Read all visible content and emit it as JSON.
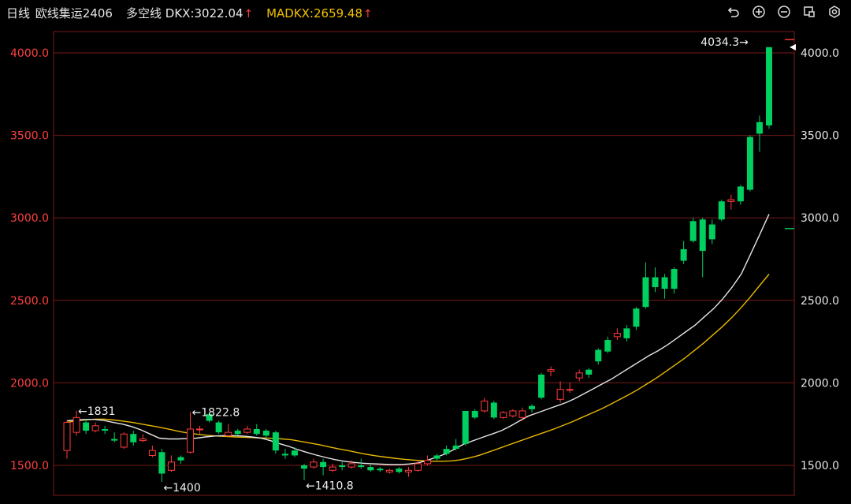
{
  "header": {
    "title_period": "日线",
    "title_symbol": "欧线集运2406",
    "ind_name": "多空线",
    "dkx_label": "DKX:",
    "dkx_value": "3022.04",
    "madkx_label": "MADKX:",
    "madkx_value": "2659.48",
    "up_arrow": "↑"
  },
  "icons": [
    "undo-icon",
    "zoom-in-icon",
    "zoom-out-icon",
    "crop-icon",
    "settings-icon"
  ],
  "colors": {
    "up": "#ff3b3b",
    "down": "#00d060",
    "grid": "#7a1a1a",
    "dkx": "#e6e6e6",
    "madkx": "#e8b800",
    "axis_text": "#ff4040",
    "right_axis_text": "#e6e6e6"
  },
  "chart_data": {
    "type": "candlestick",
    "ylim": [
      1380,
      4120
    ],
    "yticks": [
      "1500.0",
      "2000.0",
      "2500.0",
      "3000.0",
      "3500.0",
      "4000.0"
    ],
    "ytick_values": [
      1500,
      2000,
      2500,
      3000,
      3500,
      4000
    ],
    "annotations": [
      {
        "text": "←1831",
        "index": 1,
        "value": 1831,
        "side": "high"
      },
      {
        "text": "←1400",
        "index": 10,
        "value": 1400,
        "side": "low"
      },
      {
        "text": "←1822.8",
        "index": 13,
        "value": 1822.8,
        "side": "high"
      },
      {
        "text": "←1410.8",
        "index": 25,
        "value": 1410.8,
        "side": "low"
      },
      {
        "text": "4034.3→",
        "index": 72,
        "value": 4034.3,
        "side": "high-left"
      }
    ],
    "candles": [
      [
        1590,
        1760,
        1540,
        1770
      ],
      [
        1700,
        1790,
        1680,
        1831
      ],
      [
        1760,
        1710,
        1690,
        1780
      ],
      [
        1710,
        1740,
        1700,
        1760
      ],
      [
        1720,
        1710,
        1690,
        1740
      ],
      [
        1660,
        1650,
        1640,
        1700
      ],
      [
        1610,
        1690,
        1600,
        1700
      ],
      [
        1690,
        1640,
        1620,
        1710
      ],
      [
        1650,
        1660,
        1640,
        1690
      ],
      [
        1560,
        1590,
        1550,
        1620
      ],
      [
        1580,
        1450,
        1400,
        1600
      ],
      [
        1470,
        1520,
        1460,
        1560
      ],
      [
        1550,
        1530,
        1510,
        1560
      ],
      [
        1580,
        1720,
        1570,
        1822.8
      ],
      [
        1720,
        1720,
        1690,
        1740
      ],
      [
        1810,
        1770,
        1760,
        1820
      ],
      [
        1760,
        1700,
        1690,
        1770
      ],
      [
        1680,
        1700,
        1670,
        1750
      ],
      [
        1710,
        1690,
        1680,
        1720
      ],
      [
        1700,
        1720,
        1690,
        1740
      ],
      [
        1720,
        1690,
        1680,
        1750
      ],
      [
        1710,
        1680,
        1660,
        1720
      ],
      [
        1700,
        1590,
        1570,
        1710
      ],
      [
        1570,
        1560,
        1540,
        1600
      ],
      [
        1590,
        1560,
        1550,
        1610
      ],
      [
        1500,
        1480,
        1410.8,
        1510
      ],
      [
        1490,
        1520,
        1480,
        1540
      ],
      [
        1520,
        1490,
        1440,
        1540
      ],
      [
        1470,
        1490,
        1460,
        1510
      ],
      [
        1500,
        1490,
        1470,
        1520
      ],
      [
        1490,
        1510,
        1480,
        1530
      ],
      [
        1500,
        1490,
        1480,
        1540
      ],
      [
        1490,
        1470,
        1460,
        1510
      ],
      [
        1480,
        1470,
        1460,
        1490
      ],
      [
        1460,
        1470,
        1450,
        1480
      ],
      [
        1480,
        1460,
        1450,
        1490
      ],
      [
        1460,
        1470,
        1430,
        1490
      ],
      [
        1470,
        1510,
        1460,
        1530
      ],
      [
        1510,
        1530,
        1500,
        1560
      ],
      [
        1560,
        1540,
        1530,
        1570
      ],
      [
        1600,
        1570,
        1560,
        1620
      ],
      [
        1620,
        1600,
        1590,
        1660
      ],
      [
        1830,
        1630,
        1620,
        1830
      ],
      [
        1830,
        1790,
        1780,
        1840
      ],
      [
        1830,
        1890,
        1820,
        1910
      ],
      [
        1880,
        1790,
        1780,
        1890
      ],
      [
        1790,
        1820,
        1780,
        1830
      ],
      [
        1800,
        1830,
        1790,
        1840
      ],
      [
        1790,
        1830,
        1770,
        1850
      ],
      [
        1860,
        1840,
        1820,
        1870
      ],
      [
        2050,
        1910,
        1900,
        2060
      ],
      [
        2070,
        2080,
        2040,
        2100
      ],
      [
        1900,
        1960,
        1880,
        2010
      ],
      [
        1960,
        1960,
        1940,
        2000
      ],
      [
        2030,
        2060,
        2010,
        2080
      ],
      [
        2080,
        2050,
        2030,
        2090
      ],
      [
        2200,
        2130,
        2110,
        2210
      ],
      [
        2260,
        2190,
        2180,
        2280
      ],
      [
        2280,
        2300,
        2260,
        2330
      ],
      [
        2330,
        2270,
        2250,
        2350
      ],
      [
        2450,
        2340,
        2320,
        2460
      ],
      [
        2640,
        2460,
        2450,
        2730
      ],
      [
        2640,
        2580,
        2550,
        2700
      ],
      [
        2640,
        2570,
        2510,
        2660
      ],
      [
        2690,
        2570,
        2540,
        2700
      ],
      [
        2810,
        2740,
        2720,
        2860
      ],
      [
        2980,
        2860,
        2850,
        3000
      ],
      [
        2990,
        2800,
        2640,
        3000
      ],
      [
        2960,
        2870,
        2840,
        2990
      ],
      [
        3100,
        2990,
        2980,
        3110
      ],
      [
        3100,
        3110,
        3050,
        3140
      ],
      [
        3190,
        3100,
        3080,
        3200
      ],
      [
        3490,
        3170,
        3160,
        3500
      ],
      [
        3580,
        3510,
        3400,
        3620
      ],
      [
        4034.3,
        3560,
        3540,
        4034.3
      ]
    ],
    "dkx": [
      1770,
      1775,
      1778,
      1778,
      1772,
      1760,
      1750,
      1735,
      1715,
      1690,
      1665,
      1660,
      1660,
      1662,
      1665,
      1672,
      1678,
      1680,
      1680,
      1678,
      1672,
      1665,
      1650,
      1632,
      1615,
      1595,
      1578,
      1562,
      1548,
      1535,
      1525,
      1518,
      1513,
      1510,
      1507,
      1505,
      1505,
      1508,
      1515,
      1530,
      1550,
      1570,
      1600,
      1630,
      1650,
      1670,
      1690,
      1710,
      1738,
      1770,
      1800,
      1820,
      1840,
      1860,
      1880,
      1905,
      1935,
      1965,
      1995,
      2025,
      2060,
      2095,
      2130,
      2165,
      2195,
      2230,
      2270,
      2310,
      2350,
      2400,
      2450,
      2510,
      2580,
      2660,
      2780,
      2900,
      3022
    ],
    "madkx": [
      1760,
      1770,
      1776,
      1780,
      1780,
      1775,
      1768,
      1760,
      1750,
      1740,
      1730,
      1718,
      1705,
      1695,
      1688,
      1682,
      1678,
      1675,
      1672,
      1670,
      1668,
      1666,
      1664,
      1660,
      1655,
      1645,
      1635,
      1625,
      1612,
      1600,
      1590,
      1578,
      1567,
      1558,
      1550,
      1543,
      1537,
      1532,
      1528,
      1525,
      1525,
      1527,
      1533,
      1545,
      1560,
      1580,
      1600,
      1620,
      1640,
      1660,
      1680,
      1700,
      1720,
      1742,
      1765,
      1790,
      1815,
      1840,
      1868,
      1898,
      1928,
      1960,
      1995,
      2030,
      2070,
      2110,
      2150,
      2195,
      2240,
      2290,
      2340,
      2395,
      2455,
      2520,
      2590,
      2659
    ]
  }
}
